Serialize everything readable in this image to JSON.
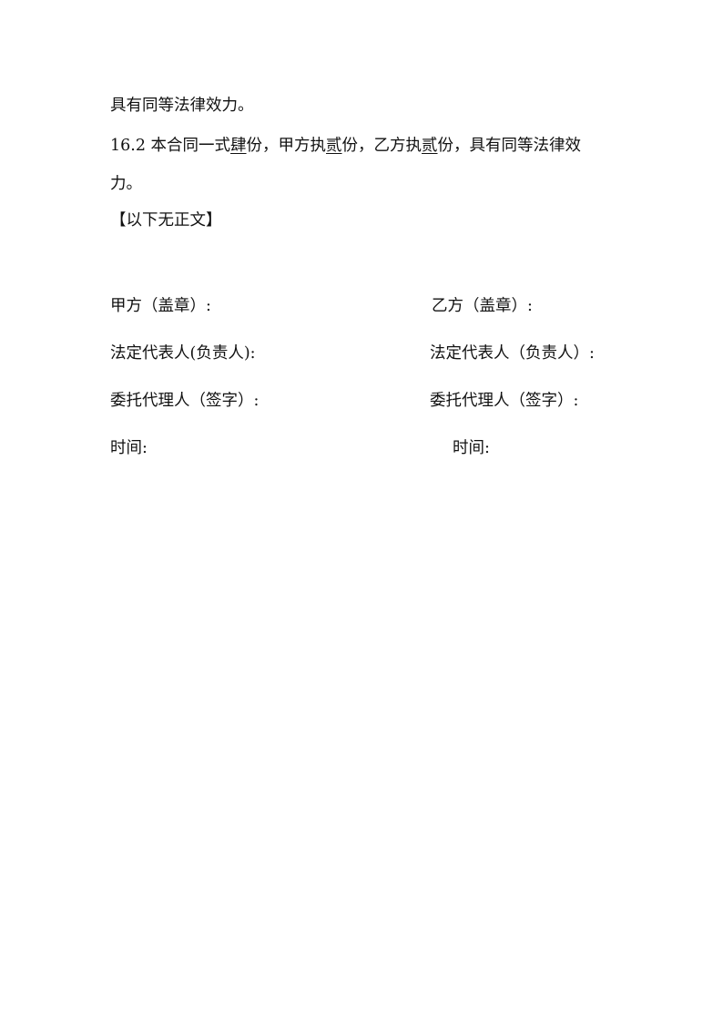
{
  "document": {
    "para1_cont": "具有同等法律效力。",
    "clause": {
      "number": "16.2",
      "t1": " 本合同一式",
      "copies_total": "肆",
      "t2": "份，甲方执",
      "copies_a": "贰",
      "t3": "份，乙方执",
      "copies_b": "贰",
      "t4": "份，具有同等法律效",
      "t5": "力。"
    },
    "end_note": "【以下无正文】",
    "signature": {
      "party_a": {
        "seal": "甲方（盖章）:",
        "legal_rep": "法定代表人(负责人):",
        "agent": "委托代理人（签字）:",
        "date": "时间:"
      },
      "party_b": {
        "seal": "乙方（盖章）:",
        "legal_rep": "法定代表人（负责人）:",
        "agent": "委托代理人（签字）:",
        "date": "时间:"
      }
    }
  }
}
